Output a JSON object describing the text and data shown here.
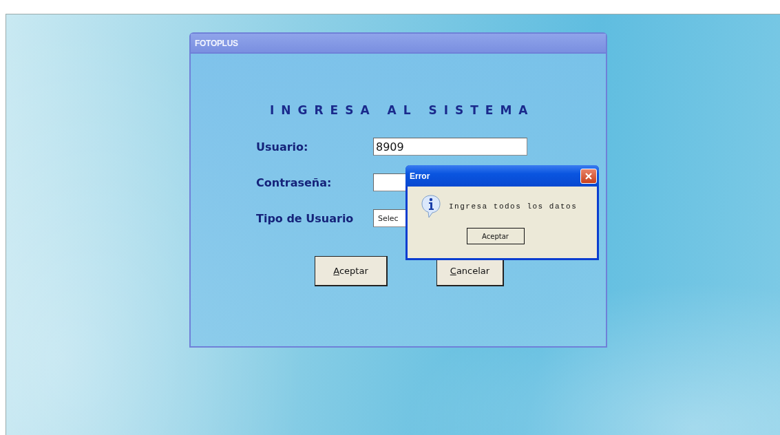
{
  "window": {
    "title": "FOTOPLUS"
  },
  "form": {
    "heading": "INGRESA AL SISTEMA",
    "fields": [
      {
        "kind": "text",
        "label": "Usuario:",
        "value": "8909"
      },
      {
        "kind": "password",
        "label": "Contraseña:"
      },
      {
        "kind": "select",
        "label": "Tipo de Usuario",
        "value": "Selec"
      }
    ],
    "buttons": [
      {
        "accel": "A",
        "rest": "ceptar"
      },
      {
        "accel": "C",
        "rest": "ancelar"
      }
    ]
  },
  "dialog": {
    "title": "Error",
    "message": "Ingresa todos los datos",
    "button": "Aceptar"
  }
}
